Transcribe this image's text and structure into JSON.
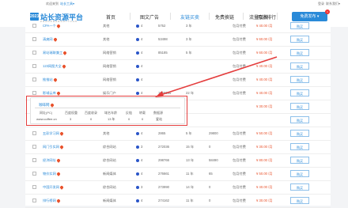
{
  "topbar": {
    "welcome": "欢迎来到",
    "tool": "站长工具▾",
    "login": "登录",
    "contact": "联系我们▾"
  },
  "logo": {
    "mark": "2023",
    "name": "站长资源平台",
    "sub": "Z H A N Z H A N G  Z I Y U A N"
  },
  "nav": [
    "首页",
    "图文广告",
    "友链买卖",
    "免费换链",
    "流量交换",
    "网站排行"
  ],
  "publish": {
    "label": "免费发布 ▾",
    "badge": "1"
  },
  "rows": [
    {
      "name": "CPA一个",
      "hot": true,
      "industry": "其他",
      "br": "",
      "weight": "4",
      "ip": "5752",
      "price_col": "3 年",
      "period": "",
      "pay": "包月付费",
      "amount": "¥ 40.00 /月"
    },
    {
      "name": "清爽网",
      "hot": true,
      "industry": "其他",
      "br": "",
      "weight": "4",
      "ip": "53498",
      "price_col": "3 年",
      "period": "",
      "pay": "包月付费",
      "amount": "¥ 60.00 /月"
    },
    {
      "name": "易站瑞联兼工",
      "hot": true,
      "industry": "网络营销",
      "br": "",
      "weight": "4",
      "ip": "85185",
      "price_col": "5 年",
      "period": "",
      "pay": "包月付费",
      "amount": "¥ 60.00 /月"
    },
    {
      "name": "123网图大全",
      "hot": true,
      "industry": "网络营销",
      "br": "",
      "weight": "4",
      "ip": "",
      "price_col": "",
      "period": "",
      "pay": "包月付费",
      "amount": "¥ 40.00 /月"
    },
    {
      "name": "推推站",
      "hot": true,
      "industry": "网络营销",
      "br": "",
      "weight": "4",
      "ip": "",
      "price_col": "",
      "period": "",
      "pay": "包月付费",
      "amount": "¥ 40.00 /月"
    },
    {
      "name": "影域云库",
      "hot": true,
      "industry": "娱乐门户",
      "br": "",
      "weight": "4",
      "ip": "1756996",
      "price_col": "22 年",
      "period": "",
      "pay": "包月付费",
      "amount": "¥ 40.00 /月"
    },
    {
      "name": "",
      "hot": false,
      "industry": "",
      "br": "",
      "weight": "",
      "ip": "",
      "price_col": "",
      "period": "",
      "pay": "",
      "amount": "¥ 30.00 /月"
    },
    {
      "name": "",
      "hot": false,
      "industry": "",
      "br": "",
      "weight": "",
      "ip": "",
      "price_col": "",
      "period": "",
      "pay": "",
      "amount": ""
    },
    {
      "name": "五彩学习网",
      "hot": true,
      "industry": "其他",
      "br": "",
      "weight": "4",
      "ip": "2865",
      "price_col": "5 年",
      "period": "29800",
      "pay": "包月付费",
      "amount": "¥ 50.00 /月"
    },
    {
      "name": "网门引实网",
      "hot": true,
      "industry": "综合网站",
      "br": "",
      "weight": "3",
      "ip": "272036",
      "price_col": "15 年",
      "period": "0",
      "pay": "包月付费",
      "amount": "¥ 30.00 /月"
    },
    {
      "name": "经济网址",
      "hot": true,
      "industry": "综合网站",
      "br": "",
      "weight": "4",
      "ip": "298766",
      "price_col": "13 年",
      "period": "58490",
      "pay": "包月付费",
      "amount": "¥ 80.00 /月"
    },
    {
      "name": "物价实网",
      "hot": true,
      "industry": "新闻媒体",
      "br": "",
      "weight": "4",
      "ip": "276661",
      "price_col": "11 年",
      "period": "65",
      "pay": "包月付费",
      "amount": "¥ 50.00 /月"
    },
    {
      "name": "中国开发网",
      "hot": true,
      "industry": "综合网站",
      "br": "",
      "weight": "3",
      "ip": "273990",
      "price_col": "14 年",
      "period": "0",
      "pay": "包月付费",
      "amount": "¥ 40.00 /月"
    },
    {
      "name": "排行榜网",
      "hot": true,
      "industry": "新闻媒体",
      "br": "",
      "weight": "4",
      "ip": "274162",
      "price_col": "11 年",
      "period": "0",
      "pay": "包月付费",
      "amount": "¥ 30.00 /月"
    }
  ],
  "row_button": "购买",
  "popup": {
    "site": "咖啡网",
    "headers": [
      "网址(PC)",
      "百度权重",
      "百度收录",
      "域名年龄",
      "反链",
      "转载",
      "数据源"
    ],
    "values": [
      "www.coffee.cn",
      "3",
      "0",
      "13 年",
      "0",
      "0",
      "爱站"
    ]
  },
  "colors": {
    "accent": "#2a8ad8",
    "annotation": "#e43d3d"
  }
}
